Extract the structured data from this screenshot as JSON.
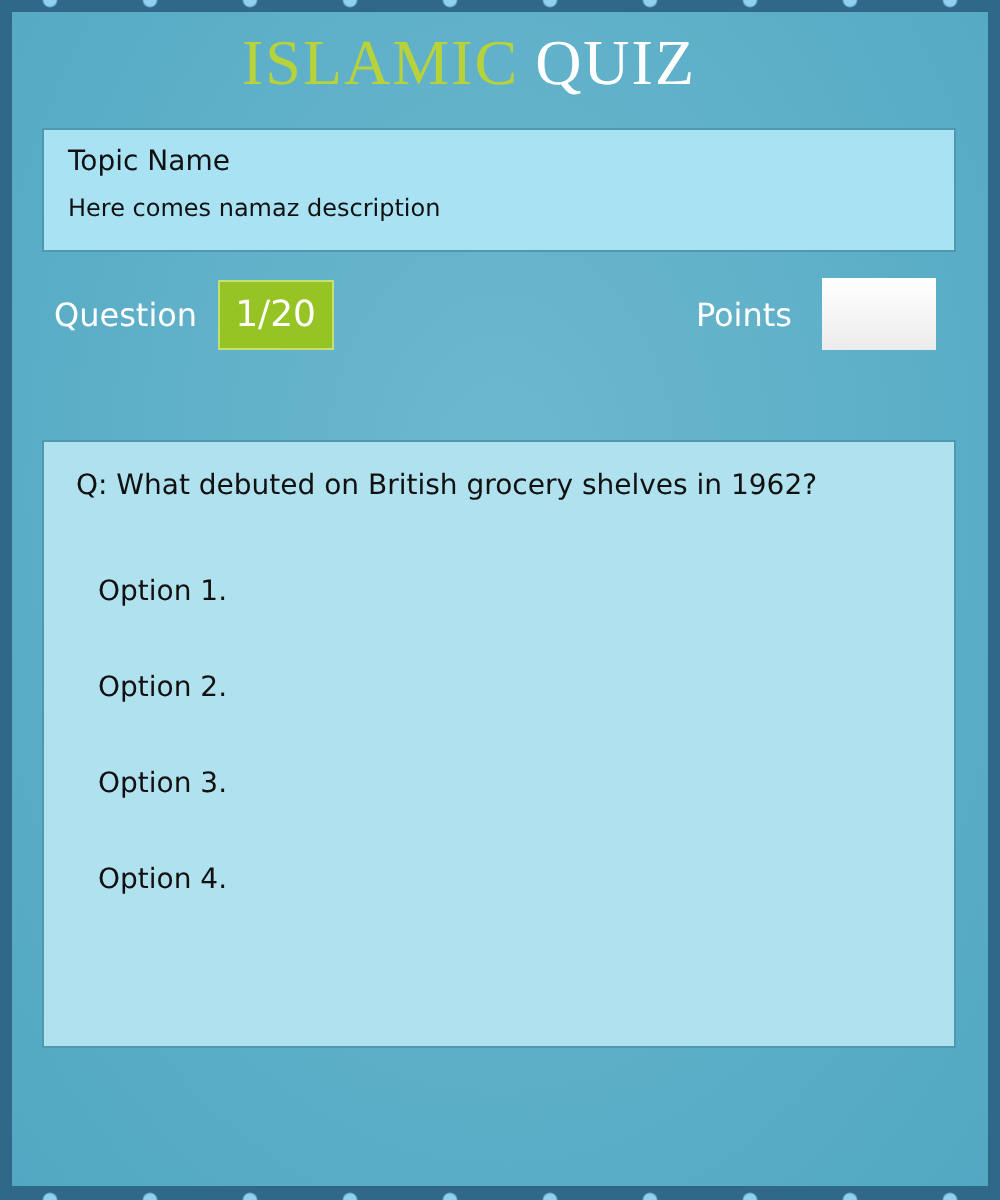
{
  "title": {
    "highlight": "ISLAMIC",
    "rest": "QUIZ"
  },
  "topic": {
    "name": "Topic Name",
    "description": "Here comes namaz description"
  },
  "progress": {
    "label": "Question",
    "counter": "1/20"
  },
  "points": {
    "label": "Points"
  },
  "question": {
    "text": "Q: What debuted on British grocery shelves in 1962?",
    "options": [
      "Option 1.",
      "Option 2.",
      "Option 3.",
      "Option 4."
    ]
  }
}
